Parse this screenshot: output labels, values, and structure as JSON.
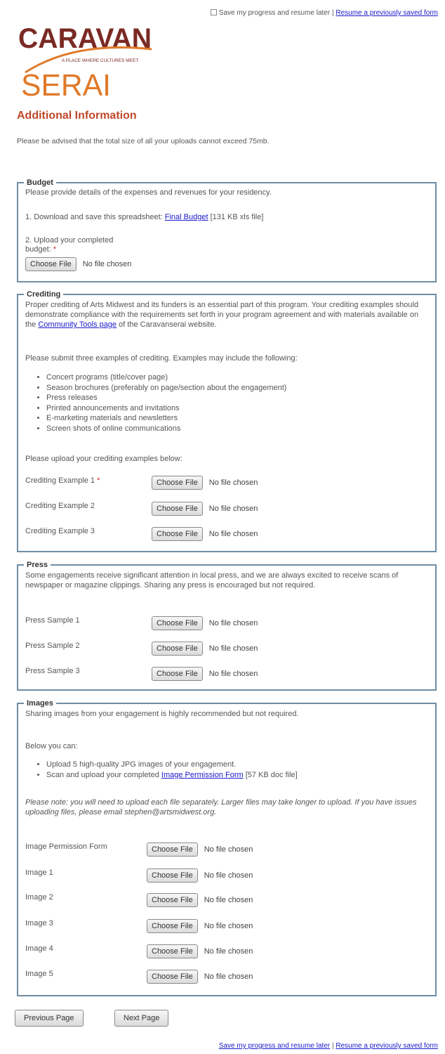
{
  "top": {
    "save_label": "Save my progress and resume later",
    "resume_link": "Resume a previously saved form"
  },
  "logo": {
    "line1": "CARAVAN",
    "line2": "SERAI",
    "tagline": "A PLACE WHERE CULTURES MEET",
    "colors": {
      "dark": "#7a2a24",
      "orange": "#e07a2a"
    }
  },
  "page_title": "Additional Information",
  "notice": "Please be advised that the total size of all your uploads cannot exceed 75mb.",
  "file_button_label": "Choose File",
  "no_file_text": "No file chosen",
  "budget": {
    "legend": "Budget",
    "intro": "Please provide details of the expenses and revenues for your residency.",
    "step1_prefix": "1. Download and save this spreadsheet: ",
    "step1_link": "Final Budget",
    "step1_suffix": " [131 KB xls file]",
    "step2_line1": "2. Upload your completed",
    "step2_line2": "budget: ",
    "required_mark": "*"
  },
  "crediting": {
    "legend": "Crediting",
    "intro_before": "Proper crediting of Arts Midwest and its funders is an essential part of this program. Your crediting examples should demonstrate compliance with the requirements set forth in your program agreement and with materials available on the ",
    "intro_link": "Community Tools page",
    "intro_after": " of the Caravanserai website.",
    "submit_text": "Please submit three examples of crediting. Examples may include the following:",
    "bullets": [
      "Concert programs (title/cover page)",
      "Season brochures (preferably on page/section about the engagement)",
      "Press releases",
      "Printed announcements and invitations",
      "E-marketing materials and newsletters",
      "Screen shots of online communications"
    ],
    "upload_text": "Please upload your crediting examples below:",
    "fields": [
      {
        "label": "Crediting Example 1",
        "required": "*"
      },
      {
        "label": "Crediting Example 2",
        "required": ""
      },
      {
        "label": "Crediting Example 3",
        "required": ""
      }
    ]
  },
  "press": {
    "legend": "Press",
    "intro": "Some engagements receive significant attention in local press, and we are always excited to receive scans of newspaper or magazine clippings. Sharing any press is encouraged but not required.",
    "fields": [
      {
        "label": "Press Sample 1"
      },
      {
        "label": "Press Sample 2"
      },
      {
        "label": "Press Sample 3"
      }
    ]
  },
  "images": {
    "legend": "Images",
    "intro": "Sharing images from your engagement is highly recommended but not required.",
    "below_text": "Below you can:",
    "bullet1": "Upload 5 high-quality JPG images of your engagement.",
    "bullet2_prefix": "Scan and upload your completed ",
    "bullet2_link": "Image Permission Form",
    "bullet2_suffix": " [57 KB doc file]",
    "note": "Please note: you will need to upload each file separately. Larger files may take longer to upload. If you have issues uploading files, please email stephen@artsmidwest.org.",
    "fields": [
      {
        "label": "Image Permission Form"
      },
      {
        "label": "Image 1"
      },
      {
        "label": "Image 2"
      },
      {
        "label": "Image 3"
      },
      {
        "label": "Image 4"
      },
      {
        "label": "Image 5"
      }
    ]
  },
  "nav": {
    "previous": "Previous Page",
    "next": "Next Page"
  },
  "bottom": {
    "save_link": "Save my progress and resume later",
    "separator": " | ",
    "resume_link": "Resume a previously saved form"
  }
}
